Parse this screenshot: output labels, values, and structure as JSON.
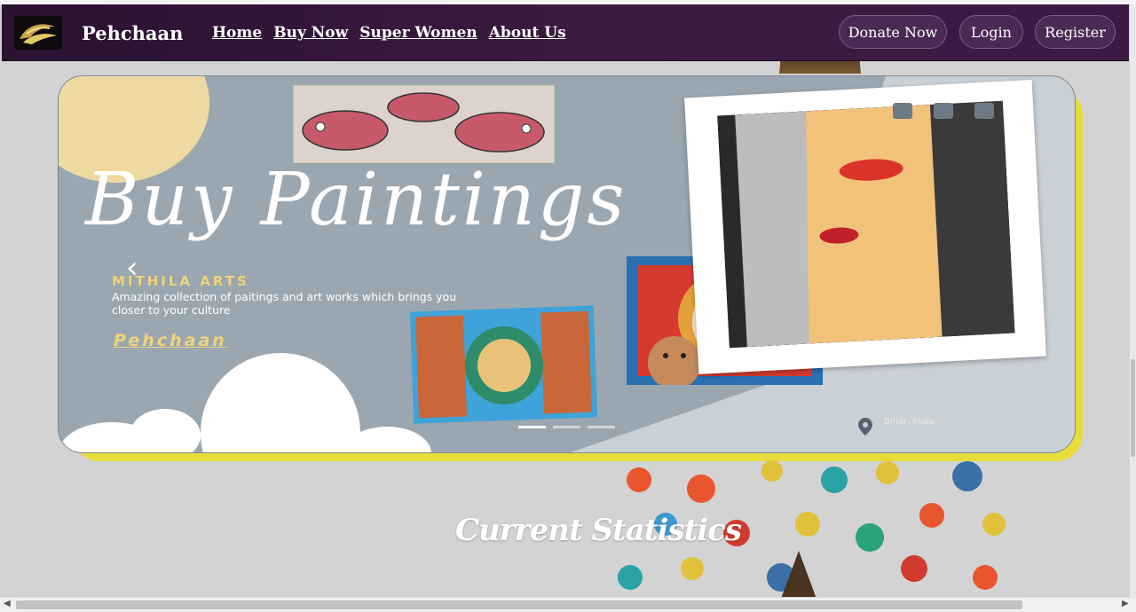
{
  "navbar": {
    "brand": "Pehchaan",
    "links": [
      "Home",
      "Buy Now",
      "Super Women",
      "About Us"
    ],
    "buttons": {
      "donate": "Donate Now",
      "login": "Login",
      "register": "Register"
    },
    "colors": {
      "background": "#3a1a40",
      "button": "#4a2a55"
    }
  },
  "carousel": {
    "title": "Buy Paintings",
    "subtitle": "MITHILA ARTS",
    "description": "Amazing collection of paitings and art works which brings you closer to  your culture",
    "tag": "Pehchaan",
    "location": "Bihar, India",
    "prev_icon": "‹",
    "slide_count": 3,
    "active_slide": 1,
    "colors": {
      "background": "#9aa7b1",
      "accent": "#efd37a",
      "shadow": "#e6dd3a"
    }
  },
  "stats": {
    "title": "Current Statistics"
  },
  "scrollbar": {
    "left_arrow": "◀",
    "right_arrow": "▶"
  }
}
